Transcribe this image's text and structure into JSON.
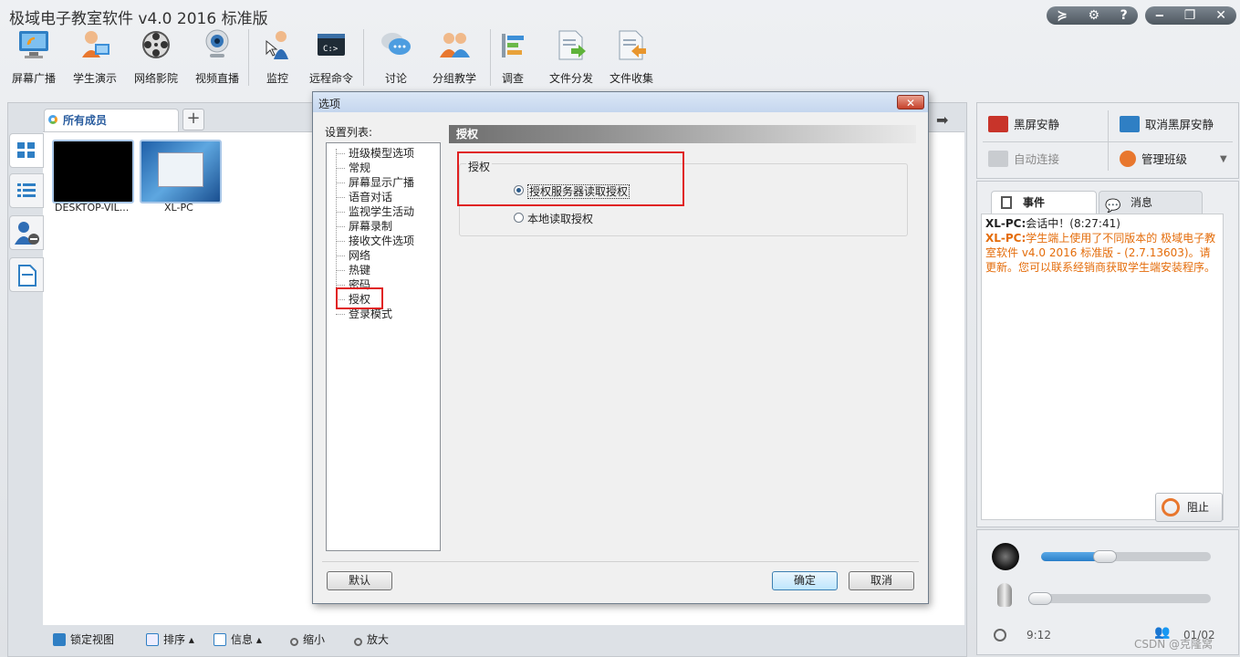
{
  "app": {
    "title": "极域电子教室软件 v4.0 2016 标准版"
  },
  "toolbar": [
    {
      "label": "屏幕广播",
      "icon": "broadcast-monitor-icon"
    },
    {
      "label": "学生演示",
      "icon": "student-demo-icon"
    },
    {
      "label": "网络影院",
      "icon": "film-reel-icon"
    },
    {
      "label": "视频直播",
      "icon": "webcam-icon"
    },
    {
      "label": "监控",
      "icon": "monitor-person-icon"
    },
    {
      "label": "远程命令",
      "icon": "command-prompt-icon"
    },
    {
      "label": "讨论",
      "icon": "chat-bubbles-icon"
    },
    {
      "label": "分组教学",
      "icon": "group-users-icon"
    },
    {
      "label": "调查",
      "icon": "survey-icon"
    },
    {
      "label": "文件分发",
      "icon": "file-send-icon"
    },
    {
      "label": "文件收集",
      "icon": "file-collect-icon"
    }
  ],
  "members": {
    "tab_label": "所有成员",
    "add_tab": "+",
    "computers": [
      {
        "name": "DESKTOP-VIL...",
        "screen": "black"
      },
      {
        "name": "XL-PC",
        "screen": "desktop"
      }
    ]
  },
  "bottom_bar": {
    "lock_view": "锁定视图",
    "sort": "排序",
    "info": "信息",
    "zoom_out": "缩小",
    "zoom_in": "放大"
  },
  "right_panel": {
    "black_screen": "黑屏安静",
    "cancel_black_screen": "取消黑屏安静",
    "auto_connect": "自动连接",
    "manage_class": "管理班级",
    "tabs": {
      "events": "事件",
      "messages": "消息"
    },
    "events": [
      {
        "source": "XL-PC:",
        "text": "会话中！(8:27:41)",
        "color": "#222222"
      },
      {
        "source": "XL-PC:",
        "text": "学生端上使用了不同版本的 极域电子教室软件 v4.0 2016 标准版 - (2.7.13603)。请更新。您可以联系经销商获取学生端安装程序。",
        "color": "#e46c0a"
      }
    ],
    "stop_button": "阻止",
    "speaker_volume": 0.36,
    "mic_volume": 0.05,
    "time": "9:12",
    "online_count": "01/02",
    "watermark": "CSDN @克隆窝"
  },
  "dialog": {
    "title": "选项",
    "close": "✕",
    "list_label": "设置列表:",
    "list_items": [
      "班级模型选项",
      "常规",
      "屏幕显示广播",
      "语音对话",
      "监视学生活动",
      "屏幕录制",
      "接收文件选项",
      "网络",
      "热键",
      "密码",
      "授权",
      "登录模式"
    ],
    "selected_item": "授权",
    "section_title": "授权",
    "group_label": "授权",
    "options": [
      {
        "label": "授权服务器读取授权",
        "selected": true
      },
      {
        "label": "本地读取授权",
        "selected": false
      }
    ],
    "buttons": {
      "default": "默认",
      "ok": "确定",
      "cancel": "取消"
    }
  },
  "colors": {
    "highlight_box": "#e02020",
    "accent": "#2a7fc9"
  }
}
